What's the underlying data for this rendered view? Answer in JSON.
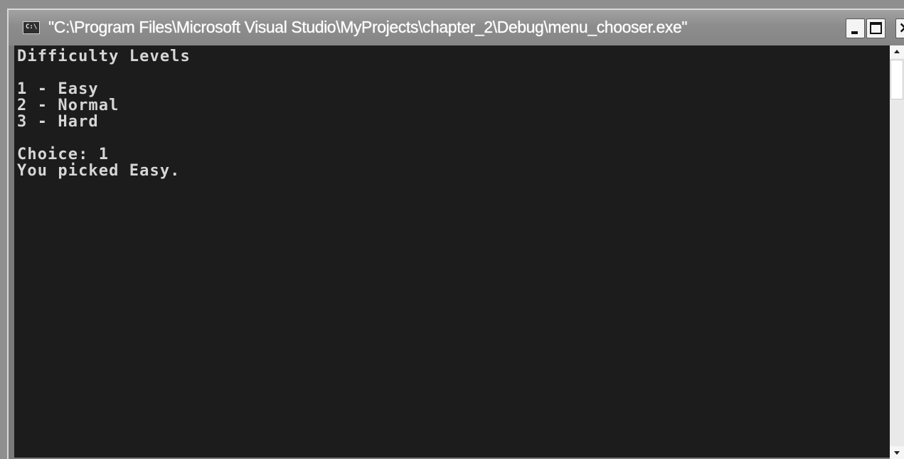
{
  "window": {
    "title": "\"C:\\Program Files\\Microsoft Visual Studio\\MyProjects\\chapter_2\\Debug\\menu_chooser.exe\"",
    "icon_label": "C:\\",
    "icon": "console-window-icon",
    "controls": {
      "minimize_icon": "minimize-icon",
      "maximize_icon": "maximize-icon",
      "close_icon": "close-icon",
      "close_glyph": "×"
    }
  },
  "console": {
    "lines": [
      "Difficulty Levels",
      "",
      "1 - Easy",
      "2 - Normal",
      "3 - Hard",
      "",
      "Choice: 1",
      "You picked Easy."
    ],
    "colors": {
      "background": "#1c1c1c",
      "text": "#d6d6d6"
    }
  }
}
